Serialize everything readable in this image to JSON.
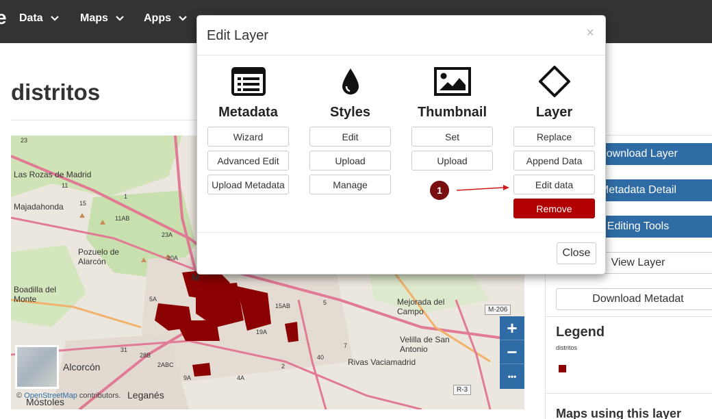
{
  "nav": {
    "brand": "e",
    "items": [
      {
        "label": "Data"
      },
      {
        "label": "Maps"
      },
      {
        "label": "Apps"
      }
    ]
  },
  "page": {
    "title": "distritos"
  },
  "map": {
    "labels": {
      "las_rozas": "Las Rozas de Madrid",
      "majadahonda": "Majadahonda",
      "pozuelo": "Pozuelo de Alarcón",
      "boadilla": "Boadilla del Monte",
      "alcorcon": "Alcorcón",
      "leganes": "Leganés",
      "mostoles": "Móstoles",
      "mejorada": "Mejorada del Campo",
      "velilla": "Velilla de San Antonio",
      "rivas": "Rivas Vaciamadrid",
      "m_letter": "M"
    },
    "road_numbers": [
      "23",
      "11",
      "1",
      "15",
      "11AB",
      "23A",
      "20A",
      "5A",
      "15AB",
      "19A",
      "28B",
      "31",
      "2ABC",
      "9A",
      "4A",
      "5",
      "7",
      "40",
      "2"
    ],
    "shields": {
      "m206": "M-206",
      "r3": "R-3"
    },
    "zoom_in": "+",
    "zoom_out": "−",
    "more": "•••",
    "attribution_prefix": "© ",
    "attribution_link": "OpenStreetMap",
    "attribution_suffix": " contributors."
  },
  "sidebar": {
    "download_layer": "Download Layer",
    "metadata_detail": "Metadata Detail",
    "editing_tools": "Editing Tools",
    "view_layer": "View Layer",
    "download_metadata": "Download Metadat",
    "legend_title": "Legend",
    "legend_item": "distritos",
    "maps_title": "Maps using this layer",
    "legend_color": "#8b0000"
  },
  "modal": {
    "title": "Edit Layer",
    "close_x": "×",
    "close_button": "Close",
    "columns": {
      "metadata": {
        "title": "Metadata",
        "buttons": [
          "Wizard",
          "Advanced Edit",
          "Upload Metadata"
        ]
      },
      "styles": {
        "title": "Styles",
        "buttons": [
          "Edit",
          "Upload",
          "Manage"
        ]
      },
      "thumbnail": {
        "title": "Thumbnail",
        "buttons": [
          "Set",
          "Upload"
        ]
      },
      "layer": {
        "title": "Layer",
        "buttons": [
          "Replace",
          "Append Data",
          "Edit data",
          "Remove"
        ]
      }
    },
    "annotation": "1"
  },
  "colors": {
    "nav_bg": "#333333",
    "primary": "#2f6ca5",
    "danger": "#b20000",
    "annotation": "#7a0f12"
  }
}
